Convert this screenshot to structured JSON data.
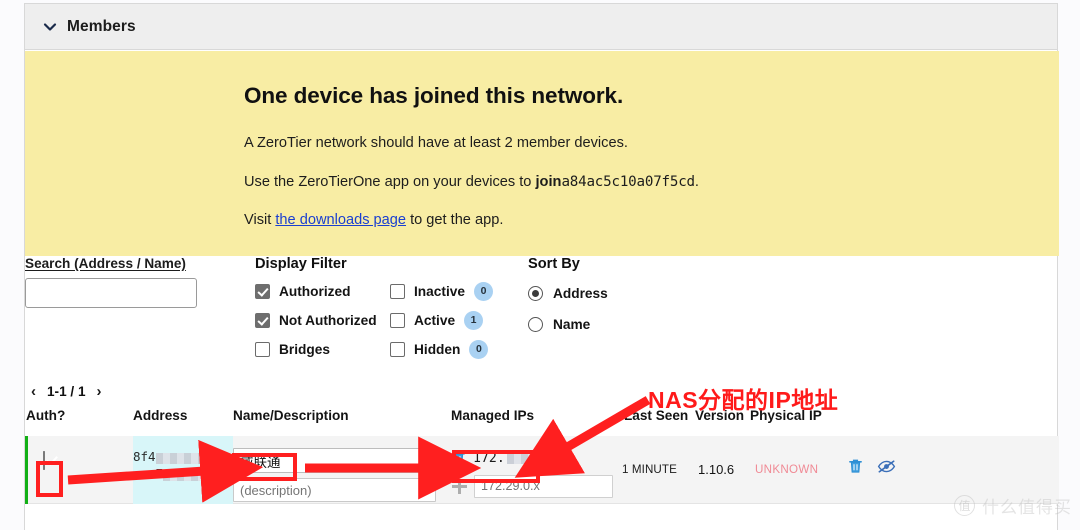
{
  "panel": {
    "title": "Members",
    "collapse_icon": "chevron-down-icon"
  },
  "banner": {
    "heading": "One device has joined this network.",
    "line1": "A ZeroTier network should have at least 2 member devices.",
    "line2_prefix": "Use the ZeroTierOne app on your devices to ",
    "line2_bold": "join",
    "line2_network_id": "a84ac5c10a07f5cd",
    "line2_suffix": ".",
    "line3_prefix": "Visit ",
    "line3_link": "the downloads page",
    "line3_suffix": " to get the app."
  },
  "search": {
    "label": "Search (Address / Name)",
    "value": "",
    "placeholder": ""
  },
  "display_filter": {
    "title": "Display Filter",
    "items": [
      {
        "label": "Authorized",
        "checked": true,
        "badge": null
      },
      {
        "label": "Inactive",
        "checked": false,
        "badge": "0"
      },
      {
        "label": "Not Authorized",
        "checked": true,
        "badge": null
      },
      {
        "label": "Active",
        "checked": false,
        "badge": "1"
      },
      {
        "label": "Bridges",
        "checked": false,
        "badge": null
      },
      {
        "label": "Hidden",
        "checked": false,
        "badge": "0"
      }
    ]
  },
  "sort_by": {
    "title": "Sort By",
    "options": [
      {
        "label": "Address",
        "selected": true
      },
      {
        "label": "Name",
        "selected": false
      }
    ]
  },
  "pagination": {
    "prev_icon": "chevron-left-icon",
    "next_icon": "chevron-right-icon",
    "range": "1-1 / 1"
  },
  "table": {
    "columns": {
      "auth": "Auth?",
      "address": "Address",
      "name_description": "Name/Description",
      "managed_ips": "Managed IPs",
      "last_seen": "Last Seen",
      "version": "Version",
      "physical_ip": "Physical IP"
    },
    "rows": [
      {
        "authorized": true,
        "address_line1": "8f4",
        "address_line2": "ce:7",
        "name_value": "威联通",
        "description_placeholder": "(description)",
        "managed_ip": "172.",
        "managed_ip_add_placeholder": "172.29.0.x",
        "last_seen": "1 MINUTE",
        "version": "1.10.6",
        "physical_ip": "UNKNOWN",
        "delete_icon": "trash-icon",
        "hide_icon": "eye-off-icon",
        "managed_ip_delete_icon": "trash-icon",
        "managed_ip_add_icon": "plus-icon"
      }
    ]
  },
  "annotations": {
    "ip_callout": "NAS分配的IP地址",
    "color": "#ff1f1f"
  },
  "watermark": {
    "badge": "值",
    "text": "什么值得买"
  },
  "colors": {
    "banner_bg": "#f8eda4",
    "header_bg": "#eeeeee",
    "row_bg": "#f4f4f4",
    "address_highlight": "#d8f6f9",
    "row_status_green": "#12b016",
    "badge_blue": "#a9d1f2",
    "physical_ip_pink": "#f08a95",
    "link_blue": "#1a3fd0",
    "annotation_red": "#ff1f1f"
  }
}
